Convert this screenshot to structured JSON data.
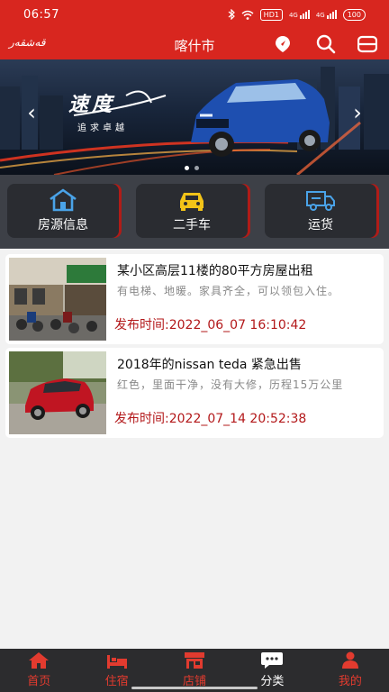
{
  "status_bar": {
    "time": "06:57",
    "network_badge": "HD1",
    "signal_1": "4G",
    "signal_2": "4G",
    "battery": "100"
  },
  "header": {
    "uyghur_text": "قەشقەر",
    "title": "喀什市",
    "icons": [
      "location-icon",
      "search-icon",
      "menu-icon"
    ],
    "background": "#d8261f"
  },
  "banner": {
    "slogan_main": "速度",
    "slogan_sub": "追求卓越",
    "slides_total": 2,
    "active_slide": 1
  },
  "categories": [
    {
      "label": "房源信息",
      "icon": "house-icon",
      "color": "#4aa3e8"
    },
    {
      "label": "二手车",
      "icon": "car-icon",
      "color": "#f2c318"
    },
    {
      "label": "运货",
      "icon": "truck-icon",
      "color": "#4aa3e8"
    }
  ],
  "listings": [
    {
      "title": "某小区高层11楼的80平方房屋出租",
      "description": "有电梯、地暖。家具齐全，可以领包入住。",
      "time": "发布时间:2022_06_07 16:10:42"
    },
    {
      "title": "2018年的nissan teda 紧急出售",
      "description": "红色，里面干净，没有大修，历程15万公里",
      "time": "发布时间:2022_07_14 20:52:38"
    }
  ],
  "bottom_nav": {
    "items": [
      {
        "label": "首页",
        "icon": "home-icon"
      },
      {
        "label": "住宿",
        "icon": "bed-icon"
      },
      {
        "label": "店铺",
        "icon": "shop-icon"
      },
      {
        "label": "分类",
        "icon": "chat-icon"
      },
      {
        "label": "我的",
        "icon": "user-icon"
      }
    ],
    "active": "分类",
    "accent": "#e23b2f"
  }
}
